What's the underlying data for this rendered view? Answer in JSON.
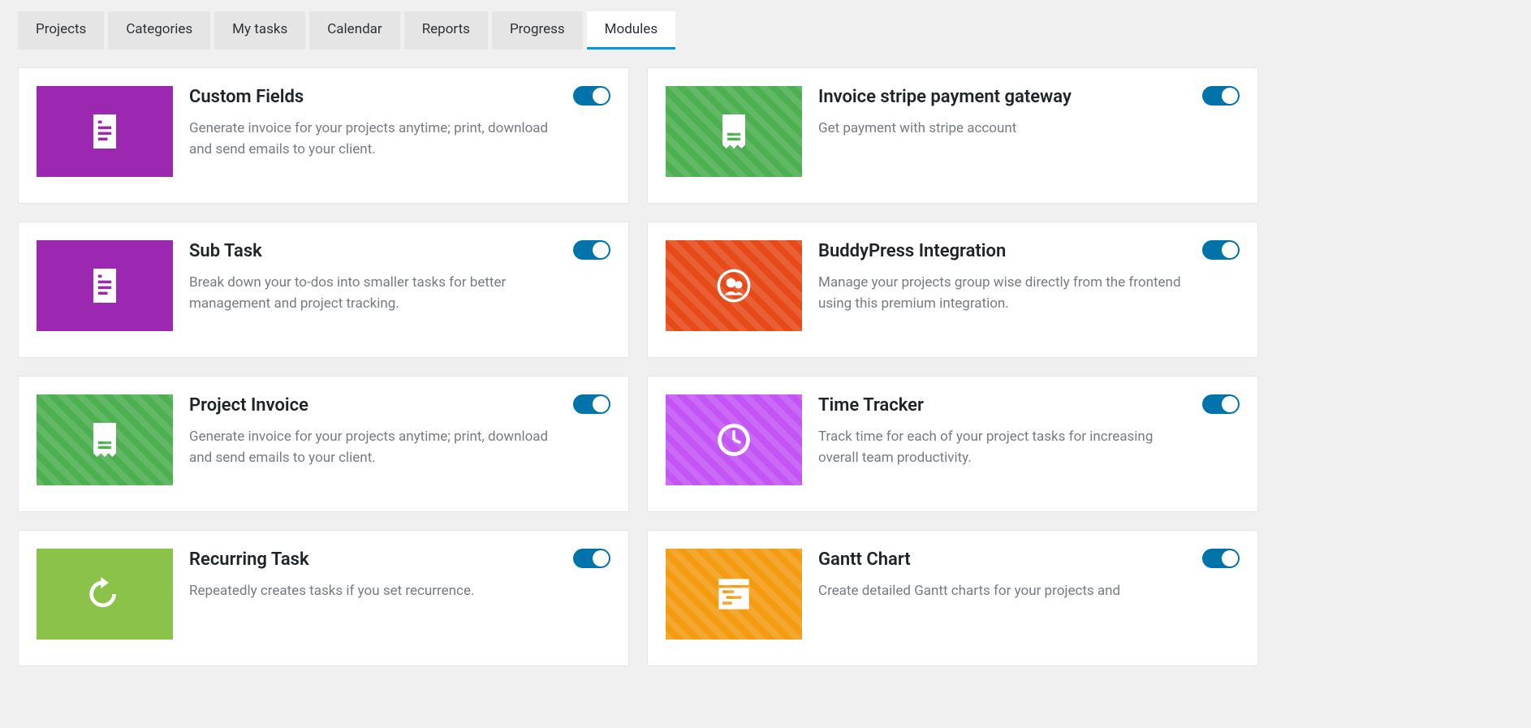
{
  "tabs": [
    {
      "label": "Projects",
      "active": false
    },
    {
      "label": "Categories",
      "active": false
    },
    {
      "label": "My tasks",
      "active": false
    },
    {
      "label": "Calendar",
      "active": false
    },
    {
      "label": "Reports",
      "active": false
    },
    {
      "label": "Progress",
      "active": false
    },
    {
      "label": "Modules",
      "active": true
    }
  ],
  "modules": [
    {
      "title": "Custom Fields",
      "desc": "Generate invoice for your projects anytime; print, download and send emails to your client.",
      "enabled": true,
      "icon": "doc",
      "color": "bg-purple",
      "hatch": false
    },
    {
      "title": "Invoice stripe payment gateway",
      "desc": "Get payment with stripe account",
      "enabled": true,
      "icon": "invoice",
      "color": "bg-green",
      "hatch": true
    },
    {
      "title": "Sub Task",
      "desc": "Break down your to-dos into smaller tasks for better management and project tracking.",
      "enabled": true,
      "icon": "doc",
      "color": "bg-purple",
      "hatch": false
    },
    {
      "title": "BuddyPress Integration",
      "desc": "Manage your projects group wise directly from the frontend using this premium integration.",
      "enabled": true,
      "icon": "group",
      "color": "bg-orange",
      "hatch": true
    },
    {
      "title": "Project Invoice",
      "desc": "Generate invoice for your projects anytime; print, download and send emails to your client.",
      "enabled": true,
      "icon": "invoice",
      "color": "bg-green",
      "hatch": true
    },
    {
      "title": "Time Tracker",
      "desc": "Track time for each of your project tasks for increasing overall team productivity.",
      "enabled": true,
      "icon": "clock",
      "color": "bg-violet",
      "hatch": true
    },
    {
      "title": "Recurring Task",
      "desc": "Repeatedly creates tasks if you set recurrence.",
      "enabled": true,
      "icon": "recur",
      "color": "bg-lime",
      "hatch": false
    },
    {
      "title": "Gantt Chart",
      "desc": "Create detailed Gantt charts for your projects and",
      "enabled": true,
      "icon": "gantt",
      "color": "bg-amber",
      "hatch": true
    }
  ]
}
